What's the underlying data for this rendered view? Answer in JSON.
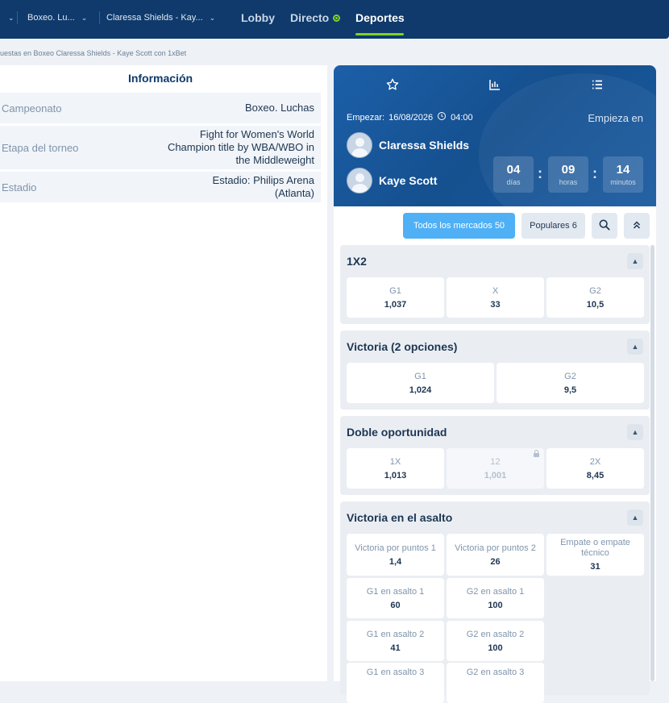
{
  "nav": {
    "selectors": [
      {
        "label": "Boxeo. Lu..."
      },
      {
        "label": "Claressa Shields - Kay..."
      }
    ],
    "links": [
      {
        "label": "Lobby"
      },
      {
        "label": "Directo"
      },
      {
        "label": "Deportes"
      }
    ],
    "breadcrumb": "uestas en Boxeo Claressa Shields - Kaye Scott con 1xBet"
  },
  "info": {
    "title": "Información",
    "rows": [
      {
        "label": "Campeonato",
        "value": "Boxeo. Luchas"
      },
      {
        "label": "Etapa del torneo",
        "value": "Fight for Women's World Champion title by WBA/WBO in the Middleweight"
      },
      {
        "label": "Estadio",
        "value": "Estadio: Philips Arena (Atlanta)"
      }
    ]
  },
  "event": {
    "tabs": [
      {
        "icon": "star-icon"
      },
      {
        "icon": "stats-icon"
      },
      {
        "icon": "list-icon"
      }
    ],
    "start_label": "Empezar:",
    "start_date": "16/08/2026",
    "start_time": "04:00",
    "begins_label": "Empieza en",
    "team1": "Claressa Shields",
    "team2": "Kaye Scott",
    "countdown": [
      {
        "value": "04",
        "unit": "días"
      },
      {
        "value": "09",
        "unit": "horas"
      },
      {
        "value": "14",
        "unit": "minutos"
      }
    ]
  },
  "filters": {
    "all_markets": "Todos los mercados 50",
    "popular": "Populares 6"
  },
  "markets": [
    {
      "title": "1X2",
      "odds": [
        {
          "label": "G1",
          "value": "1,037"
        },
        {
          "label": "X",
          "value": "33"
        },
        {
          "label": "G2",
          "value": "10,5"
        }
      ]
    },
    {
      "title": "Victoria (2 opciones)",
      "odds": [
        {
          "label": "G1",
          "value": "1,024"
        },
        {
          "label": "G2",
          "value": "9,5"
        }
      ]
    },
    {
      "title": "Doble oportunidad",
      "odds": [
        {
          "label": "1X",
          "value": "1,013"
        },
        {
          "label": "12",
          "value": "1,001",
          "locked": true
        },
        {
          "label": "2X",
          "value": "8,45"
        }
      ]
    },
    {
      "title": "Victoria en el asalto",
      "odds": [
        {
          "label": "Victoria por puntos 1",
          "value": "1,4"
        },
        {
          "label": "Victoria por puntos 2",
          "value": "26"
        },
        {
          "label": "Empate o empate técnico",
          "value": "31"
        },
        {
          "label": "G1 en asalto 1",
          "value": "60"
        },
        {
          "label": "G2 en asalto 1",
          "value": "100"
        },
        {
          "label": "G1 en asalto 2",
          "value": "41"
        },
        {
          "label": "G2 en asalto 2",
          "value": "100"
        },
        {
          "label": "G1 en asalto 3",
          "value": ""
        },
        {
          "label": "G2 en asalto 3",
          "value": ""
        }
      ]
    }
  ],
  "colors": {
    "nav_bg": "#0f3a6b",
    "accent_green": "#7ed321",
    "primary_pill": "#4fb0f5",
    "event_bg": "#1c5fa8"
  }
}
